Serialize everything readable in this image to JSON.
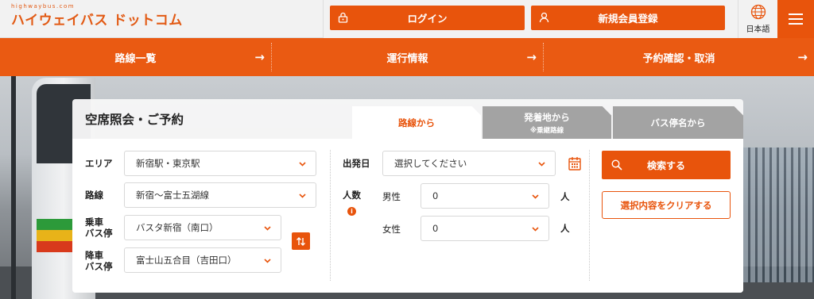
{
  "header": {
    "logo_url": "highwaybus.com",
    "logo_text": "ハイウェイバス ドットコム",
    "login_label": "ログイン",
    "register_label": "新規会員登録",
    "language_label": "日本語"
  },
  "nav": {
    "items": [
      {
        "label": "路線一覧"
      },
      {
        "label": "運行情報"
      },
      {
        "label": "予約確認・取消"
      }
    ]
  },
  "panel": {
    "title": "空席照会・ご予約",
    "tabs": [
      {
        "label": "路線から",
        "sub": "",
        "active": true
      },
      {
        "label": "発着地から",
        "sub": "※乗継路線",
        "active": false
      },
      {
        "label": "バス停名から",
        "sub": "",
        "active": false
      }
    ],
    "area_label": "エリア",
    "area_value": "新宿駅・東京駅",
    "route_label": "路線",
    "route_value": "新宿～富士五湖線",
    "board_label_1": "乗車",
    "board_label_2": "バス停",
    "board_value": "バスタ新宿（南口）",
    "alight_label_1": "降車",
    "alight_label_2": "バス停",
    "alight_value": "富士山五合目（吉田口）",
    "date_label": "出発日",
    "date_placeholder": "選択してください",
    "pax_label": "人数",
    "male_label": "男性",
    "male_value": "0",
    "female_label": "女性",
    "female_value": "0",
    "unit_label": "人",
    "info_glyph": "i",
    "search_label": "検索する",
    "clear_label": "選択内容をクリアする"
  },
  "colors": {
    "accent": "#e8540c",
    "tab_inactive": "#a3a3a3"
  }
}
